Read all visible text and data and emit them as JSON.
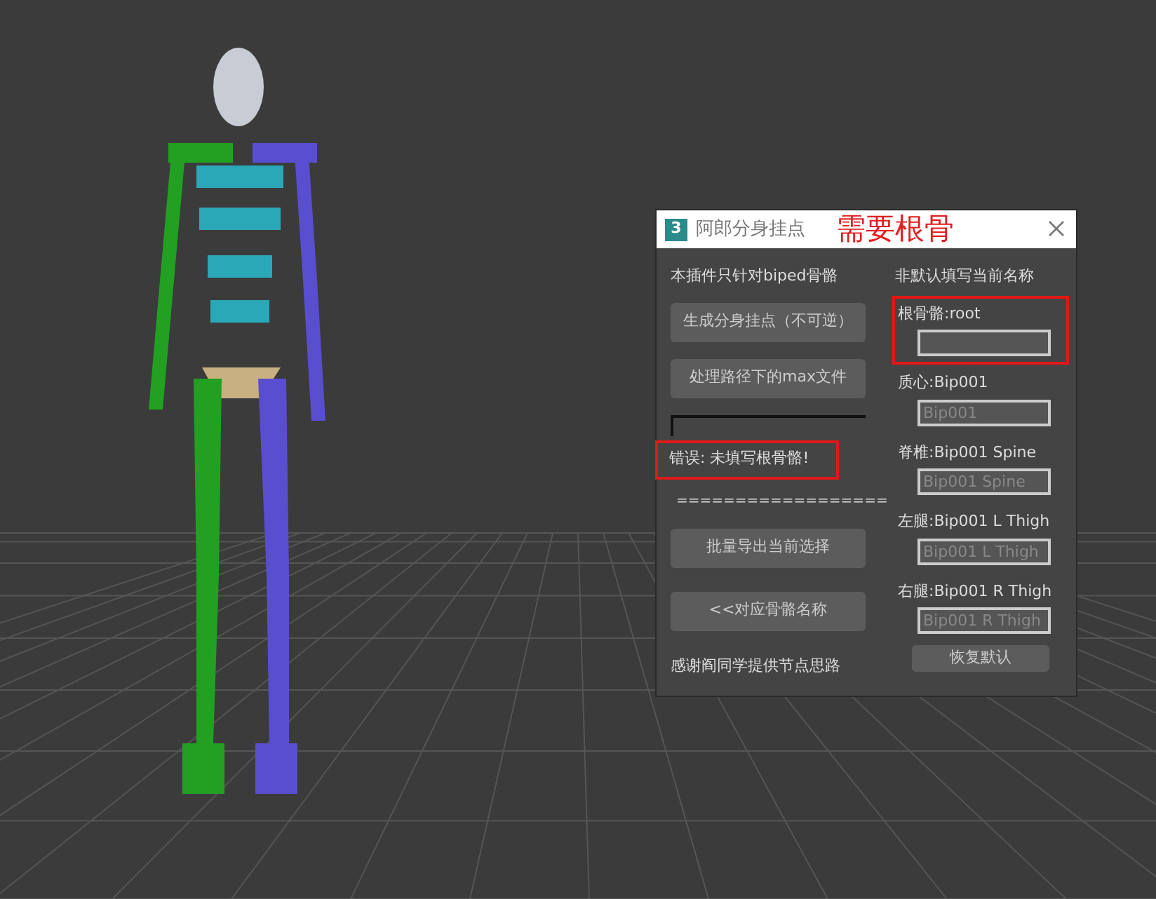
{
  "window": {
    "title": "阿郎分身挂点",
    "app_icon": "3",
    "annotation": "需要根骨"
  },
  "left": {
    "note": "本插件只针对biped骨骼",
    "buttons_top": [
      "生成分身挂点（不可逆）",
      "处理路径下的max文件"
    ],
    "progress": {
      "level": 0
    },
    "error": {
      "text": "错误: 未填写根骨骼!",
      "highlighted": true
    },
    "separator": "==================",
    "buttons_bottom": [
      "批量导出当前选择",
      "<<对应骨骼名称"
    ],
    "credit": "感谢阎同学提供节点思路"
  },
  "right": {
    "heading": "非默认填写当前名称",
    "fields": [
      {
        "label": "根骨骼:root",
        "highlighted": true
      },
      {
        "label": "质心:Bip001",
        "placeholder": "Bip001",
        "highlighted": false
      },
      {
        "label": "脊椎:Bip001 Spine",
        "placeholder": "Bip001 Spine",
        "highlighted": false
      },
      {
        "label": "左腿:Bip001 L Thigh",
        "placeholder": "Bip001 L Thigh",
        "highlighted": false
      },
      {
        "label": "右腿:Bip001 R Thigh",
        "placeholder": "Bip001 R Thigh",
        "highlighted": false
      }
    ],
    "reset_button": "恢复默认"
  }
}
